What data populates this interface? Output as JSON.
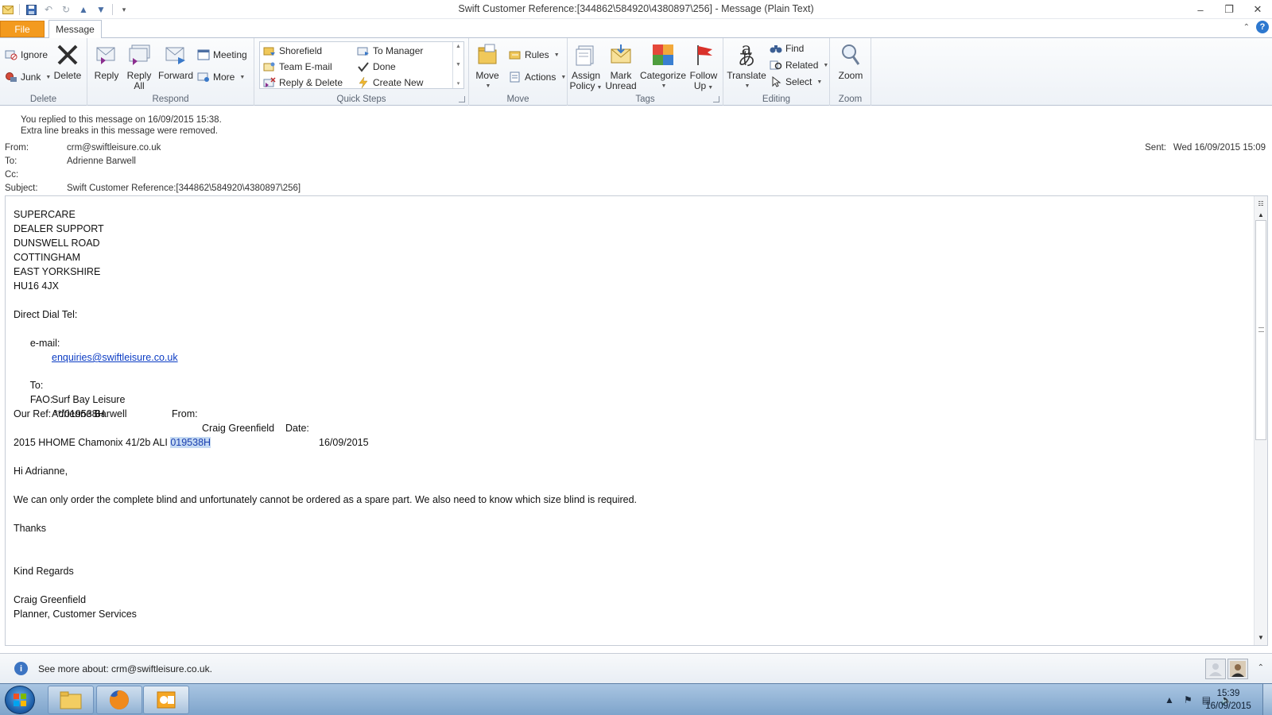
{
  "window": {
    "title": "Swift Customer Reference:[344862\\584920\\4380897\\256]  - Message (Plain Text)"
  },
  "tabs": {
    "file": "File",
    "message": "Message"
  },
  "ribbon": {
    "delete_group": {
      "label": "Delete",
      "ignore": "Ignore",
      "junk": "Junk",
      "delete": "Delete"
    },
    "respond_group": {
      "label": "Respond",
      "reply": "Reply",
      "reply_all_1": "Reply",
      "reply_all_2": "All",
      "forward": "Forward",
      "meeting": "Meeting",
      "more": "More"
    },
    "quicksteps_group": {
      "label": "Quick Steps",
      "items": [
        "Shorefield",
        "Team E-mail",
        "Reply & Delete",
        "To Manager",
        "Done",
        "Create New"
      ]
    },
    "move_group": {
      "label": "Move",
      "move": "Move",
      "rules": "Rules",
      "actions": "Actions"
    },
    "tags_group": {
      "label": "Tags",
      "assign_1": "Assign",
      "assign_2": "Policy",
      "mark_1": "Mark",
      "mark_2": "Unread",
      "categorize": "Categorize",
      "follow_1": "Follow",
      "follow_2": "Up"
    },
    "editing_group": {
      "label": "Editing",
      "translate": "Translate",
      "find": "Find",
      "related": "Related",
      "select": "Select"
    },
    "zoom_group": {
      "label": "Zoom",
      "zoom": "Zoom"
    }
  },
  "infobar": {
    "line1": "You replied to this message on 16/09/2015 15:38.",
    "line2": "Extra line breaks in this message were removed."
  },
  "header": {
    "from_label": "From:",
    "from": "crm@swiftleisure.co.uk",
    "to_label": "To:",
    "to": "Adrienne Barwell",
    "cc_label": "Cc:",
    "cc": "",
    "subject_label": "Subject:",
    "subject": "Swift Customer Reference:[344862\\584920\\4380897\\256]",
    "sent_label": "Sent:",
    "sent": "Wed 16/09/2015 15:09"
  },
  "body": {
    "l1": "SUPERCARE",
    "l2": "DEALER SUPPORT",
    "l3": "DUNSWELL ROAD",
    "l4": "COTTINGHAM",
    "l5": "EAST YORKSHIRE",
    "l6": "HU16 4JX",
    "dial": "Direct Dial Tel:",
    "email_label": "e-mail:",
    "email": "enquiries@swiftleisure.co.uk",
    "to_label": "To:",
    "to_value": "Surf Bay Leisure",
    "from_label": "From:",
    "from_value": "Craig Greenfield",
    "fao_label": "FAO:",
    "fao_value": "Adrienne Barwell",
    "date_label": "Date:",
    "date_value": "16/09/2015",
    "ref": "Our Ref: **/019538H",
    "model_prefix": "2015 HHOME Chamonix 41/2b ALI ",
    "model_highlight": "019538H",
    "greeting": "Hi Adrianne,",
    "message": "We can only order the complete blind and unfortunately cannot be ordered as a spare part. We also need to know which size blind is required.",
    "thanks": "Thanks",
    "regards": "Kind Regards",
    "sig_name": "Craig Greenfield",
    "sig_title": "Planner, Customer Services"
  },
  "people_pane": {
    "text": "See more about: crm@swiftleisure.co.uk."
  },
  "taskbar": {
    "time": "15:39",
    "date": "16/09/2015"
  }
}
